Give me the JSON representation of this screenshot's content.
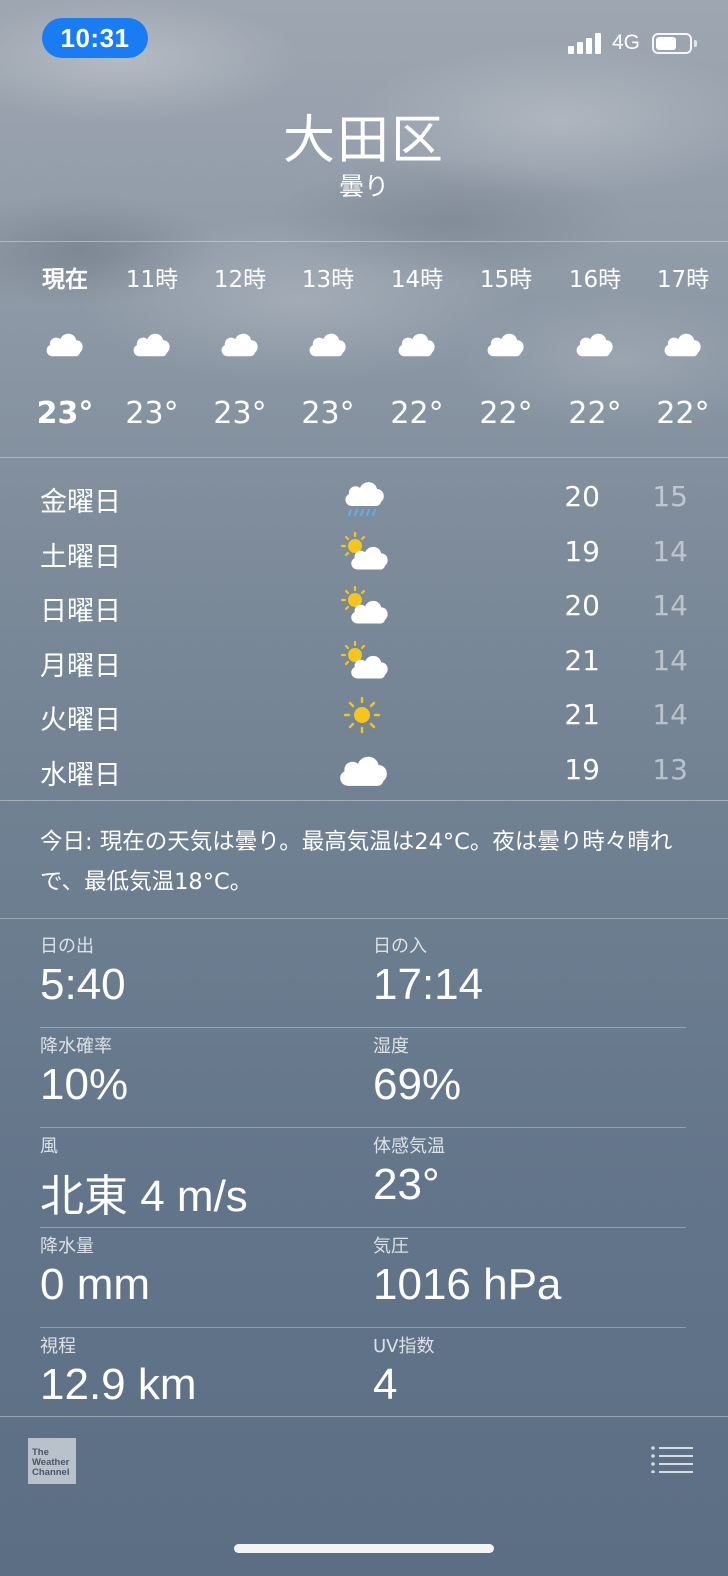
{
  "status_bar": {
    "time": "10:31",
    "network": "4G"
  },
  "location": {
    "city": "大田区",
    "condition": "曇り"
  },
  "hourly": [
    {
      "label": "現在",
      "icon": "cloud-icon",
      "temp": "23°",
      "current": true
    },
    {
      "label": "11時",
      "icon": "cloud-icon",
      "temp": "23°"
    },
    {
      "label": "12時",
      "icon": "cloud-icon",
      "temp": "23°"
    },
    {
      "label": "13時",
      "icon": "cloud-icon",
      "temp": "23°"
    },
    {
      "label": "14時",
      "icon": "cloud-icon",
      "temp": "22°"
    },
    {
      "label": "15時",
      "icon": "cloud-icon",
      "temp": "22°"
    },
    {
      "label": "16時",
      "icon": "cloud-icon",
      "temp": "22°"
    },
    {
      "label": "17時",
      "icon": "cloud-icon",
      "temp": "22°"
    }
  ],
  "daily": [
    {
      "day": "金曜日",
      "icon": "rain-cloud-icon",
      "high": "20",
      "low": "15"
    },
    {
      "day": "土曜日",
      "icon": "partly-sunny-icon",
      "high": "19",
      "low": "14"
    },
    {
      "day": "日曜日",
      "icon": "partly-sunny-icon",
      "high": "20",
      "low": "14"
    },
    {
      "day": "月曜日",
      "icon": "partly-sunny-icon",
      "high": "21",
      "low": "14"
    },
    {
      "day": "火曜日",
      "icon": "sun-icon",
      "high": "21",
      "low": "14"
    },
    {
      "day": "水曜日",
      "icon": "cloud-icon",
      "high": "19",
      "low": "13"
    }
  ],
  "summary": "今日: 現在の天気は曇り。最高気温は24°C。夜は曇り時々晴れで、最低気温18°C。",
  "details": [
    {
      "left": {
        "label": "日の出",
        "value": "5:40"
      },
      "right": {
        "label": "日の入",
        "value": "17:14"
      }
    },
    {
      "left": {
        "label": "降水確率",
        "value": "10%"
      },
      "right": {
        "label": "湿度",
        "value": "69%"
      }
    },
    {
      "left": {
        "label": "風",
        "value": "北東 4 m/s"
      },
      "right": {
        "label": "体感気温",
        "value": "23°"
      }
    },
    {
      "left": {
        "label": "降水量",
        "value": "0 mm"
      },
      "right": {
        "label": "気圧",
        "value": "1016 hPa"
      }
    },
    {
      "left": {
        "label": "視程",
        "value": "12.9 km"
      },
      "right": {
        "label": "UV指数",
        "value": "4"
      }
    }
  ],
  "footer": {
    "logo_text": "The Weather Channel",
    "logo_lines": [
      "The",
      "Weather",
      "Channel"
    ]
  },
  "colors": {
    "time_pill": "#1a7cf2",
    "sun": "#f5c51f",
    "rain": "#5ab2f0"
  }
}
